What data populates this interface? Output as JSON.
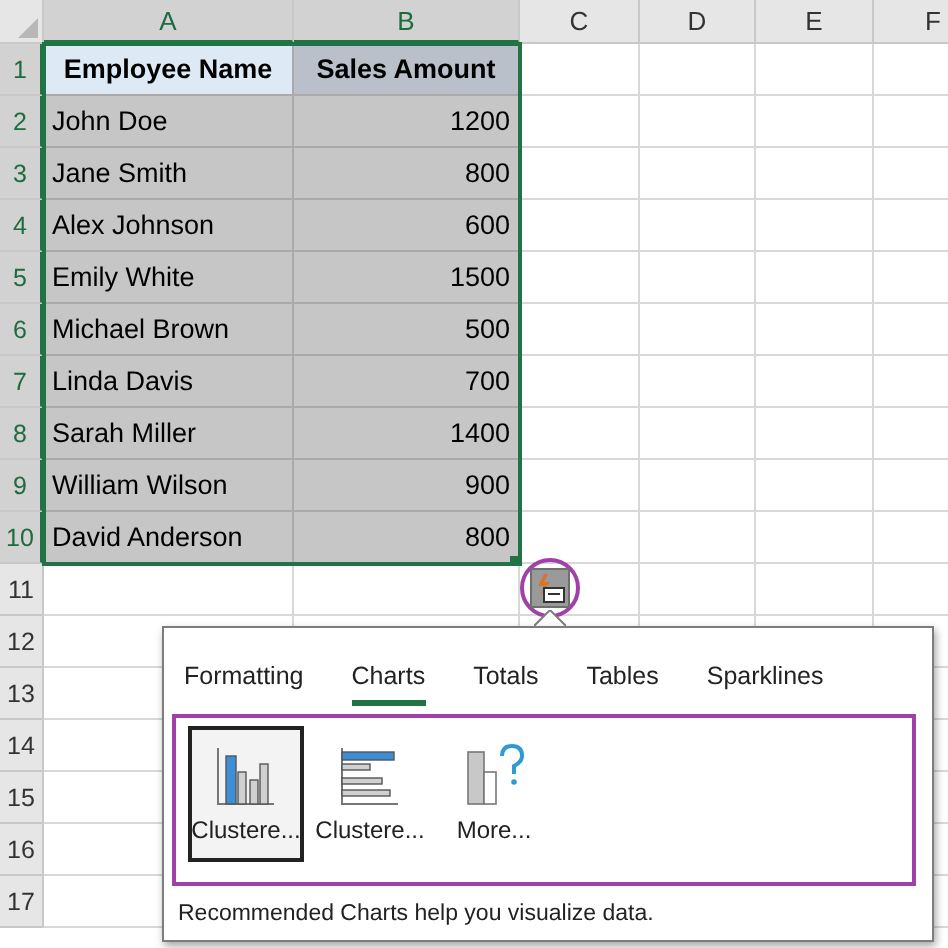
{
  "columns": [
    {
      "label": "A",
      "selected": true
    },
    {
      "label": "B",
      "selected": true
    },
    {
      "label": "C",
      "selected": false
    },
    {
      "label": "D",
      "selected": false
    },
    {
      "label": "E",
      "selected": false
    },
    {
      "label": "F",
      "selected": false
    }
  ],
  "rows": [
    {
      "label": "1",
      "selected": true
    },
    {
      "label": "2",
      "selected": true
    },
    {
      "label": "3",
      "selected": true
    },
    {
      "label": "4",
      "selected": true
    },
    {
      "label": "5",
      "selected": true
    },
    {
      "label": "6",
      "selected": true
    },
    {
      "label": "7",
      "selected": true
    },
    {
      "label": "8",
      "selected": true
    },
    {
      "label": "9",
      "selected": true
    },
    {
      "label": "10",
      "selected": true
    },
    {
      "label": "11",
      "selected": false
    },
    {
      "label": "12",
      "selected": false
    },
    {
      "label": "13",
      "selected": false
    },
    {
      "label": "14",
      "selected": false
    },
    {
      "label": "15",
      "selected": false
    },
    {
      "label": "16",
      "selected": false
    },
    {
      "label": "17",
      "selected": false
    }
  ],
  "table": {
    "headers": [
      "Employee Name",
      "Sales Amount"
    ],
    "rows": [
      [
        "John Doe",
        "1200"
      ],
      [
        "Jane Smith",
        "800"
      ],
      [
        "Alex Johnson",
        "600"
      ],
      [
        "Emily White",
        "1500"
      ],
      [
        "Michael Brown",
        "500"
      ],
      [
        "Linda Davis",
        "700"
      ],
      [
        "Sarah Miller",
        "1400"
      ],
      [
        "William Wilson",
        "900"
      ],
      [
        "David Anderson",
        "800"
      ]
    ]
  },
  "quick_analysis": {
    "tabs": [
      {
        "label": "Formatting",
        "selected": false
      },
      {
        "label": "Charts",
        "selected": true
      },
      {
        "label": "Totals",
        "selected": false
      },
      {
        "label": "Tables",
        "selected": false
      },
      {
        "label": "Sparklines",
        "selected": false
      }
    ],
    "options": [
      {
        "label": "Clustere...",
        "kind": "column",
        "selected": true
      },
      {
        "label": "Clustere...",
        "kind": "bar",
        "selected": false
      },
      {
        "label": "More...",
        "kind": "more",
        "selected": false
      }
    ],
    "description": "Recommended Charts help you visualize data."
  }
}
